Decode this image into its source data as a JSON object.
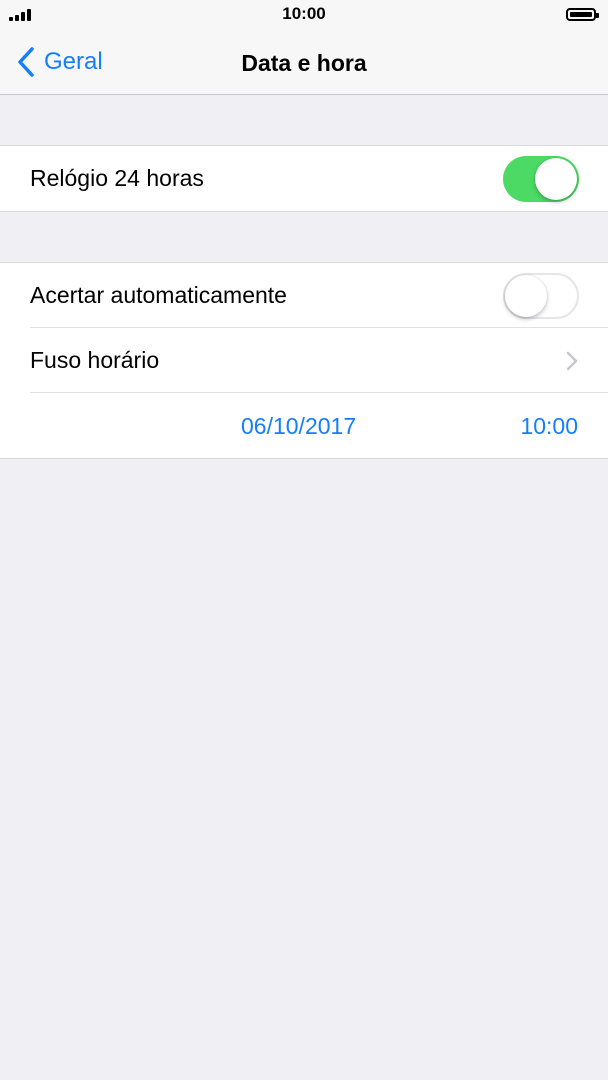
{
  "status_bar": {
    "time": "10:00"
  },
  "nav": {
    "back_label": "Geral",
    "title": "Data e hora"
  },
  "settings": {
    "clock_24h": {
      "label": "Relógio 24 horas",
      "enabled": true
    },
    "auto_set": {
      "label": "Acertar automaticamente",
      "enabled": false
    },
    "timezone": {
      "label": "Fuso horário"
    },
    "date": "06/10/2017",
    "time": "10:00"
  },
  "colors": {
    "accent": "#147efb",
    "toggle_on": "#4cd964",
    "background": "#efeff4"
  },
  "icons": [
    "signal-icon",
    "battery-icon",
    "back-chevron-icon",
    "disclosure-chevron-icon"
  ]
}
